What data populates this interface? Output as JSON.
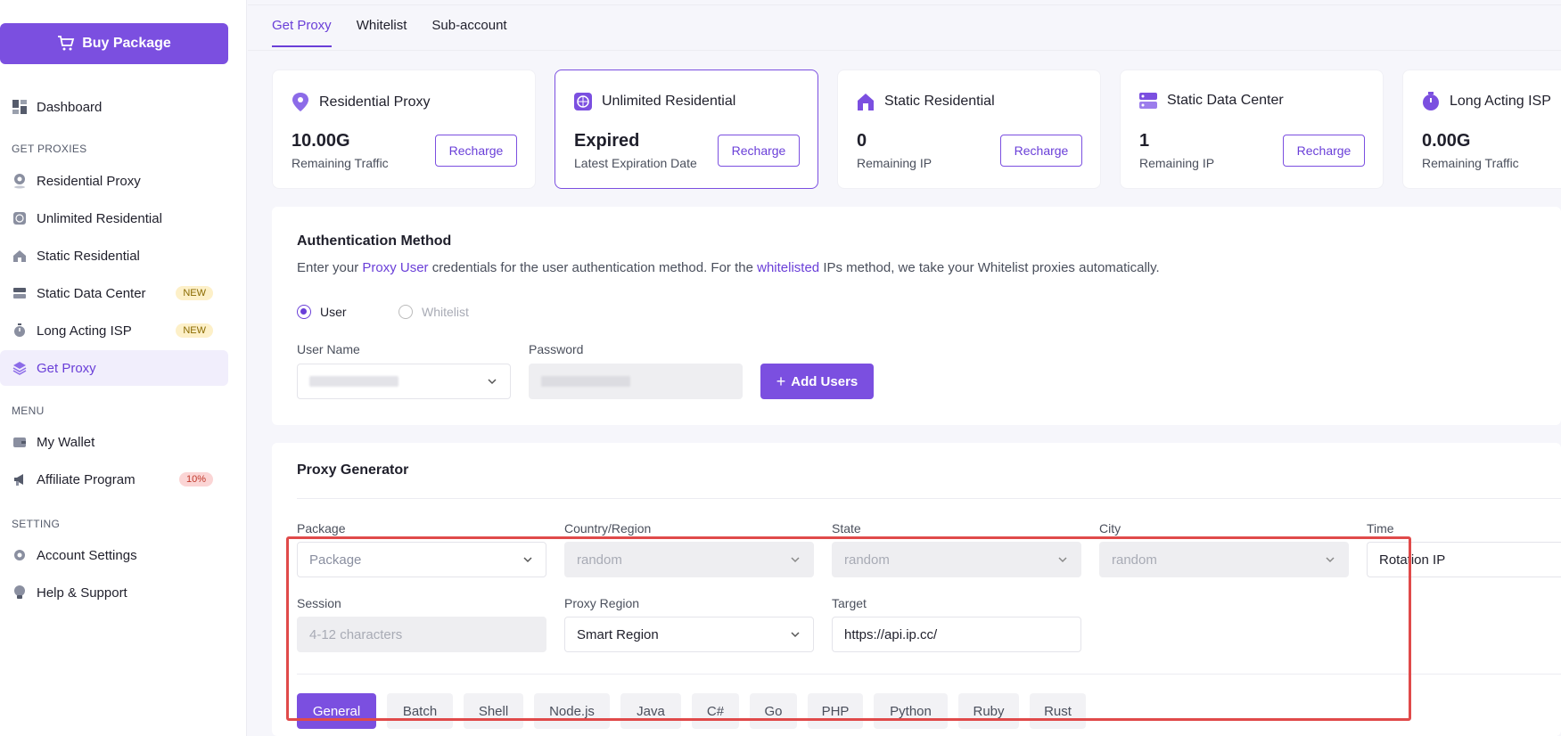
{
  "sidebar": {
    "buy_label": "Buy Package",
    "dashboard": "Dashboard",
    "section_proxies": "GET PROXIES",
    "residential": "Residential Proxy",
    "unlimited": "Unlimited Residential",
    "static_res": "Static Residential",
    "static_dc": "Static Data Center",
    "static_dc_badge": "NEW",
    "long_isp": "Long Acting ISP",
    "long_isp_badge": "NEW",
    "get_proxy": "Get Proxy",
    "section_menu": "MENU",
    "wallet": "My Wallet",
    "affiliate": "Affiliate Program",
    "affiliate_badge": "10%",
    "section_setting": "SETTING",
    "account": "Account Settings",
    "help": "Help & Support"
  },
  "tabs": [
    "Get Proxy",
    "Whitelist",
    "Sub-account"
  ],
  "cards": [
    {
      "title": "Residential Proxy",
      "value": "10.00G",
      "sub": "Remaining Traffic",
      "button": "Recharge"
    },
    {
      "title": "Unlimited Residential",
      "value": "Expired",
      "sub": "Latest Expiration Date",
      "button": "Recharge"
    },
    {
      "title": "Static Residential",
      "value": "0",
      "sub": "Remaining IP",
      "button": "Recharge"
    },
    {
      "title": "Static Data Center",
      "value": "1",
      "sub": "Remaining IP",
      "button": "Recharge"
    },
    {
      "title": "Long Acting ISP",
      "value": "0.00G",
      "sub": "Remaining Traffic"
    }
  ],
  "auth": {
    "title": "Authentication Method",
    "desc_1": "Enter your ",
    "desc_link1": "Proxy User",
    "desc_2": " credentials for the user authentication method. For the ",
    "desc_link2": "whitelisted",
    "desc_3": " IPs method, we take your Whitelist proxies automatically.",
    "radio_user": "User",
    "radio_whitelist": "Whitelist",
    "username_label": "User Name",
    "password_label": "Password",
    "add_users": "Add Users"
  },
  "generator": {
    "title": "Proxy Generator",
    "package_label": "Package",
    "package_placeholder": "Package",
    "country_label": "Country/Region",
    "country_value": "random",
    "state_label": "State",
    "state_value": "random",
    "city_label": "City",
    "city_value": "random",
    "time_label": "Time",
    "time_value": "Rotation IP",
    "session_label": "Session",
    "session_placeholder": "4-12 characters",
    "region_label": "Proxy Region",
    "region_value": "Smart Region",
    "target_label": "Target",
    "target_value": "https://api.ip.cc/",
    "langs": [
      "General",
      "Batch",
      "Shell",
      "Node.js",
      "Java",
      "C#",
      "Go",
      "PHP",
      "Python",
      "Ruby",
      "Rust"
    ]
  },
  "colors": {
    "accent": "#7b4fe0",
    "highlight": "#e04a4a"
  }
}
